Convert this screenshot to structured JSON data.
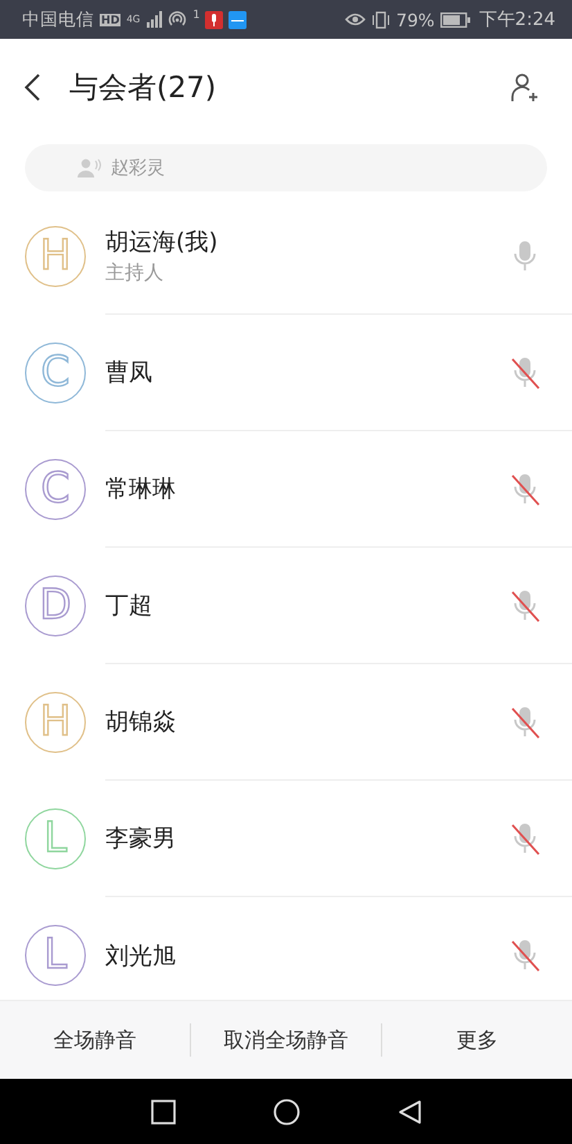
{
  "status_bar": {
    "carrier": "中国电信",
    "hd": "HD",
    "network": "4G",
    "hotspot_count": "1",
    "battery": "79%",
    "time": "下午2:24"
  },
  "header": {
    "title": "与会者(27)"
  },
  "speaking": {
    "name": "赵彩灵"
  },
  "participants": [
    {
      "initial": "H",
      "color": "#e0c089",
      "name": "胡运海(我)",
      "role": "主持人",
      "muted": false
    },
    {
      "initial": "C",
      "color": "#8fb8d8",
      "name": "曹凤",
      "muted": true
    },
    {
      "initial": "C",
      "color": "#a99bd0",
      "name": "常琳琳",
      "muted": true
    },
    {
      "initial": "D",
      "color": "#a99bd0",
      "name": "丁超",
      "muted": true
    },
    {
      "initial": "H",
      "color": "#e0c089",
      "name": "胡锦焱",
      "muted": true
    },
    {
      "initial": "L",
      "color": "#8fd69e",
      "name": "李豪男",
      "muted": true
    },
    {
      "initial": "L",
      "color": "#a99bd0",
      "name": "刘光旭",
      "muted": true
    }
  ],
  "actions": [
    "全场静音",
    "取消全场静音",
    "更多"
  ]
}
